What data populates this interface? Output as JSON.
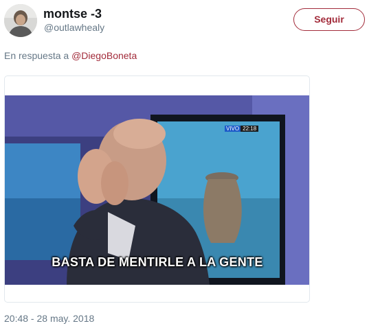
{
  "author": {
    "display_name": "montse -3",
    "handle": "@outlawhealy"
  },
  "follow_button": {
    "label": "Seguir"
  },
  "reply_context": {
    "prefix": "En respuesta a",
    "mention": "@DiegoBoneta"
  },
  "media": {
    "caption": "BASTA DE MENTIRLE A LA GENTE",
    "tv_live_label": "VIVO",
    "tv_clock": "22:18"
  },
  "timestamp": "20:48 - 28 may. 2018",
  "colors": {
    "accent": "#a22b3a",
    "secondary_text": "#657786",
    "primary_text": "#14171a",
    "card_border": "#e1e8ed"
  },
  "icons": {
    "avatar": "user-photo"
  }
}
